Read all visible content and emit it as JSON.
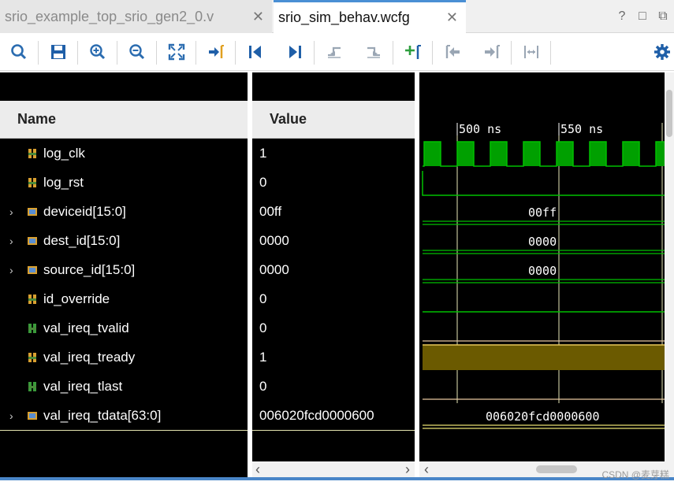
{
  "tabs": [
    {
      "label": "srio_example_top_srio_gen2_0.v",
      "active": false
    },
    {
      "label": "srio_sim_behav.wcfg",
      "active": true
    }
  ],
  "close_glyph": "✕",
  "window_controls": {
    "help": "?",
    "restore": "□",
    "maximize": "⧉"
  },
  "toolbar": {
    "buttons": [
      "search-icon",
      "save-icon",
      "zoom-in-icon",
      "zoom-out-icon",
      "zoom-fit-icon",
      "go-to-cursor-icon",
      "go-to-time-zero-icon",
      "go-to-last-time-icon",
      "previous-transition-icon",
      "next-transition-icon",
      "add-marker-icon",
      "previous-marker-icon",
      "next-marker-icon",
      "swap-cursors-icon"
    ],
    "settings_icon": "gear-icon"
  },
  "columns": {
    "name": "Name",
    "value": "Value"
  },
  "signals": [
    {
      "name": "log_clk",
      "value": "1",
      "expandable": false,
      "kind": "bit"
    },
    {
      "name": "log_rst",
      "value": "0",
      "expandable": false,
      "kind": "bit"
    },
    {
      "name": "deviceid[15:0]",
      "value": "00ff",
      "expandable": true,
      "kind": "bus"
    },
    {
      "name": "dest_id[15:0]",
      "value": "0000",
      "expandable": true,
      "kind": "bus"
    },
    {
      "name": "source_id[15:0]",
      "value": "0000",
      "expandable": true,
      "kind": "bus"
    },
    {
      "name": "id_override",
      "value": "0",
      "expandable": false,
      "kind": "bit"
    },
    {
      "name": "val_ireq_tvalid",
      "value": "0",
      "expandable": false,
      "kind": "bit"
    },
    {
      "name": "val_ireq_tready",
      "value": "1",
      "expandable": false,
      "kind": "bit"
    },
    {
      "name": "val_ireq_tlast",
      "value": "0",
      "expandable": false,
      "kind": "bit"
    },
    {
      "name": "val_ireq_tdata[63:0]",
      "value": "006020fcd0000600",
      "expandable": true,
      "kind": "bus"
    }
  ],
  "waveform": {
    "time_labels": [
      "500 ns",
      "550 ns"
    ],
    "bus_labels": [
      "00ff",
      "0000",
      "0000",
      "006020fcd0000600"
    ]
  },
  "colors": {
    "wave_green": "#00c000",
    "clock_fill": "#00a000",
    "tready_fill": "#6b5a00",
    "tdata_yellow": "#e8e070",
    "cursor_line": "#e8e8b8"
  },
  "watermark": "CSDN @麦芽糕"
}
